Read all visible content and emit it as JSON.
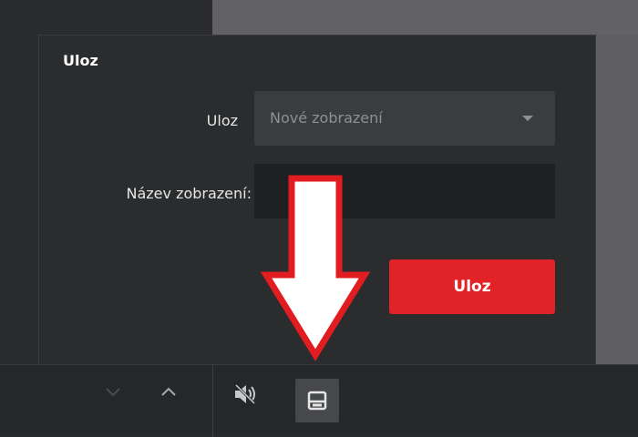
{
  "dialog": {
    "title": "Uloz",
    "save_label": "Uloz",
    "save_select_value": "Nové zobrazení",
    "name_label": "Název zobrazení:",
    "name_value": "",
    "save_button": "Uloz"
  },
  "toolbar": {
    "icons": [
      "chevron-down-icon",
      "chevron-up-icon",
      "mute-icon",
      "save-icon"
    ]
  },
  "annotation": {
    "arrow_color": "#e11d22",
    "arrow_fill": "#ffffff"
  },
  "colors": {
    "accent": "#e12226",
    "dialog_bg": "#2b2c2e",
    "input_bg": "#1f2022",
    "select_bg": "#3b3c3f"
  }
}
